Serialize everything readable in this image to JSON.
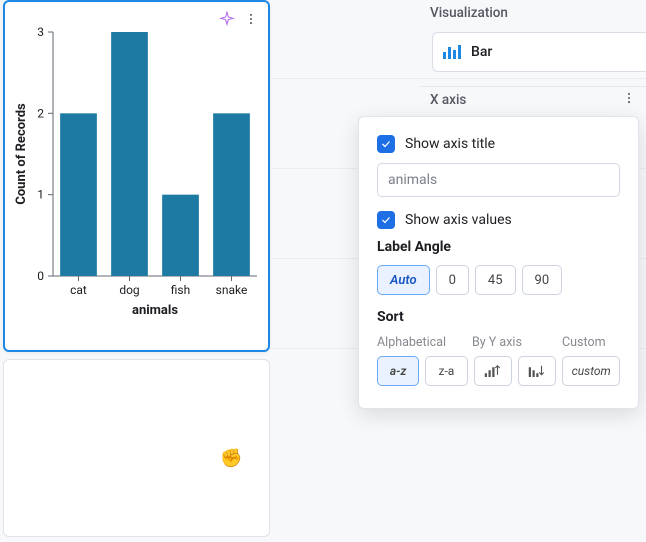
{
  "visualization": {
    "header": "Visualization",
    "type_label": "Bar"
  },
  "xaxis": {
    "header": "X axis",
    "show_title_label": "Show axis title",
    "show_title_checked": true,
    "title_value": "animals",
    "show_values_label": "Show axis values",
    "show_values_checked": true,
    "label_angle": {
      "title": "Label Angle",
      "options": [
        "Auto",
        "0",
        "45",
        "90"
      ],
      "selected": "Auto"
    },
    "sort": {
      "title": "Sort",
      "headers": [
        "Alphabetical",
        "By Y axis",
        "Custom"
      ],
      "az": "a-z",
      "za": "z-a",
      "custom": "custom",
      "selected": "a-z"
    }
  },
  "chart_data": {
    "type": "bar",
    "categories": [
      "cat",
      "dog",
      "fish",
      "snake"
    ],
    "values": [
      2,
      3,
      1,
      2
    ],
    "title": "",
    "xlabel": "animals",
    "ylabel": "Count of Records",
    "ylim": [
      0,
      3
    ],
    "yticks": [
      0,
      1,
      2,
      3
    ]
  },
  "colors": {
    "bar": "#1c7aa3",
    "accent": "#1e88e5"
  }
}
